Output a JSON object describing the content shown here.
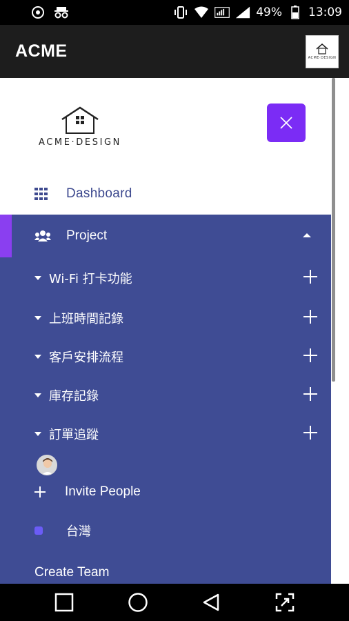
{
  "status_bar": {
    "battery": "49%",
    "time": "13:09",
    "icons": [
      "vpn-icon",
      "incognito-icon",
      "vibrate-icon",
      "wifi-icon",
      "mobile-data-icon",
      "signal-icon",
      "battery-icon"
    ]
  },
  "app_bar": {
    "title": "ACME",
    "logo_text": "ACME·DESIGN"
  },
  "drawer": {
    "logo_text": "ACME·DESIGN",
    "close_icon": "close-icon",
    "dashboard_label": "Dashboard",
    "project_label": "Project",
    "sub_items": [
      {
        "label": "Wi-Fi 打卡功能"
      },
      {
        "label": "上班時間記錄"
      },
      {
        "label": "客戶安排流程"
      },
      {
        "label": "庫存記錄"
      },
      {
        "label": "訂單追蹤"
      }
    ],
    "invite_label": "Invite People",
    "team_label": "台灣",
    "create_team_label": "Create Team"
  },
  "colors": {
    "panel": "#3f4c94",
    "accent": "#7b2cf5",
    "dashboard_text": "#3e4a8f"
  },
  "nav_bar": {
    "buttons": [
      "square-icon",
      "circle-icon",
      "back-triangle-icon",
      "expand-icon"
    ]
  }
}
